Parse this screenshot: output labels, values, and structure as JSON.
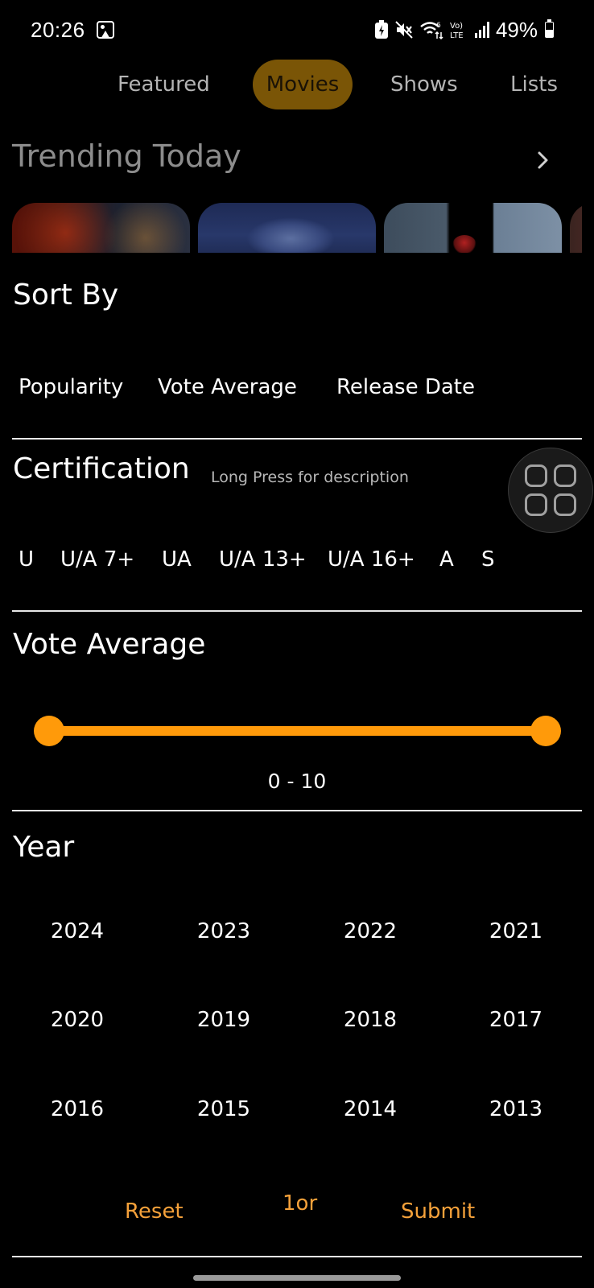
{
  "status_bar": {
    "time": "20:26",
    "battery": "49%",
    "icons": [
      "image-icon",
      "battery-saver-icon",
      "mute-icon",
      "wifi-calling-icon",
      "volte-icon",
      "signal-icon",
      "battery-icon"
    ]
  },
  "tabs": [
    {
      "label": "Featured",
      "active": false
    },
    {
      "label": "Movies",
      "active": true
    },
    {
      "label": "Shows",
      "active": false
    },
    {
      "label": "Lists",
      "active": false
    }
  ],
  "trending": {
    "title": "Trending Today"
  },
  "sort": {
    "title": "Sort By",
    "options": [
      "Popularity",
      "Vote Average",
      "Release Date"
    ]
  },
  "certification": {
    "title": "Certification",
    "subtitle": "Long Press for description",
    "options": [
      "U",
      "U/A 7+",
      "UA",
      "U/A 13+",
      "U/A 16+",
      "A",
      "S"
    ]
  },
  "vote_average": {
    "title": "Vote Average",
    "min": 0,
    "max": 10,
    "range_label": "0 - 10"
  },
  "year": {
    "title": "Year",
    "options": [
      "2024",
      "2023",
      "2022",
      "2021",
      "2020",
      "2019",
      "2018",
      "2017",
      "2016",
      "2015",
      "2014",
      "2013"
    ]
  },
  "actions": {
    "reset": "Reset",
    "middle": "1or",
    "submit": "Submit"
  },
  "colors": {
    "accent": "#ff9a0a",
    "active_tab_bg": "#7a5506",
    "action_text": "#f5a13a"
  }
}
